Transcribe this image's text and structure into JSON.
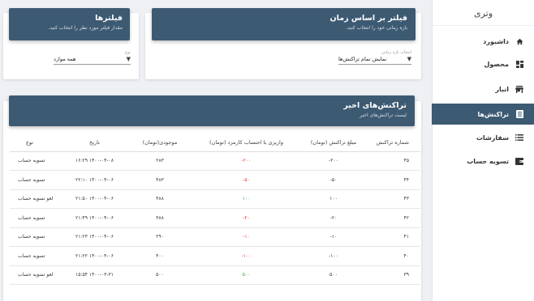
{
  "sidebar": {
    "brand": "وتری",
    "items": [
      {
        "label": "داشبورد",
        "icon": "home-icon"
      },
      {
        "label": "محصول",
        "icon": "dashboard-grid-icon"
      },
      {
        "label": "انبار",
        "icon": "store-icon"
      },
      {
        "label": "تراکنش‌ها",
        "icon": "list-icon",
        "active": true
      },
      {
        "label": "سفارشات",
        "icon": "list-bullets-icon"
      },
      {
        "label": "تسویه حساب",
        "icon": "wallet-icon"
      }
    ]
  },
  "time_filter": {
    "title": "فیلتر بر اساس زمان",
    "subtitle": "بازه زمانی خود را انتخاب کنید.",
    "field_label": "انتخاب بازه زمانی",
    "field_value": "نمایش تمام تراکنش‌ها"
  },
  "filters": {
    "title": "فیلترها",
    "subtitle": "مقدار فیلتر مورد نظر را انتخاب کنید.",
    "field_label": "نوع",
    "field_value": "همه موارد"
  },
  "transactions": {
    "title": "تراکنش‌های اخیر",
    "subtitle": "لیست تراکنش‌های اخیر",
    "columns": [
      "شماره تراکنش",
      "مبلغ تراکنش (تومان)",
      "واریزی با احتساب کارمزد (تومان)",
      "موجودی(تومان)",
      "تاریخ",
      "نوع"
    ],
    "rows": [
      {
        "id": "۴۵",
        "amount": "۲۰۰-",
        "net": "۲۰۰-",
        "net_color": "red",
        "balance": "۲۸۳",
        "date": "۱۴۰۰-۰۴-۰۸ ۱۶:۲۹",
        "type": "تسویه حساب"
      },
      {
        "id": "۴۴",
        "amount": "۵۰-",
        "net": "۵۰-",
        "net_color": "red",
        "balance": "۴۸۳",
        "date": "۱۴۰۰-۰۴-۰۶ ۲۲:۱۰",
        "type": "تسویه حساب"
      },
      {
        "id": "۴۳",
        "amount": "۱۰۰",
        "net": "۱۰۰",
        "net_color": "green",
        "balance": "۴۸۸",
        "date": "۱۴۰۰-۰۴-۰۶ ۲۱:۵۰",
        "type": "لغو تسویه حساب"
      },
      {
        "id": "۴۲",
        "amount": "۲۰-",
        "net": "۲۰-",
        "net_color": "red",
        "balance": "۳۸۸",
        "date": "۱۴۰۰-۰۴-۰۶ ۲۱:۴۹",
        "type": "تسویه حساب"
      },
      {
        "id": "۴۱",
        "amount": "۱۰-",
        "net": "۱۰-",
        "net_color": "red",
        "balance": "۲۹۰",
        "date": "۱۴۰۰-۰۴-۰۶ ۲۱:۲۳",
        "type": "تسویه حساب"
      },
      {
        "id": "۴۰",
        "amount": "۱۰۰-",
        "net": "۱۰۰-",
        "net_color": "red",
        "balance": "۴۰۰",
        "date": "۱۴۰۰-۰۴-۰۶ ۲۱:۲۲",
        "type": "تسویه حساب"
      },
      {
        "id": "۳۹",
        "amount": "۵۰۰",
        "net": "۵۰۰",
        "net_color": "green",
        "balance": "۵۰۰",
        "date": "۱۴۰۰-۰۳-۳۱ ۱۵:۵۴",
        "type": "لغو تسویه حساب"
      }
    ]
  },
  "colors": {
    "header": "#3d5a73",
    "negative": "#e53935",
    "positive": "#43a047"
  }
}
